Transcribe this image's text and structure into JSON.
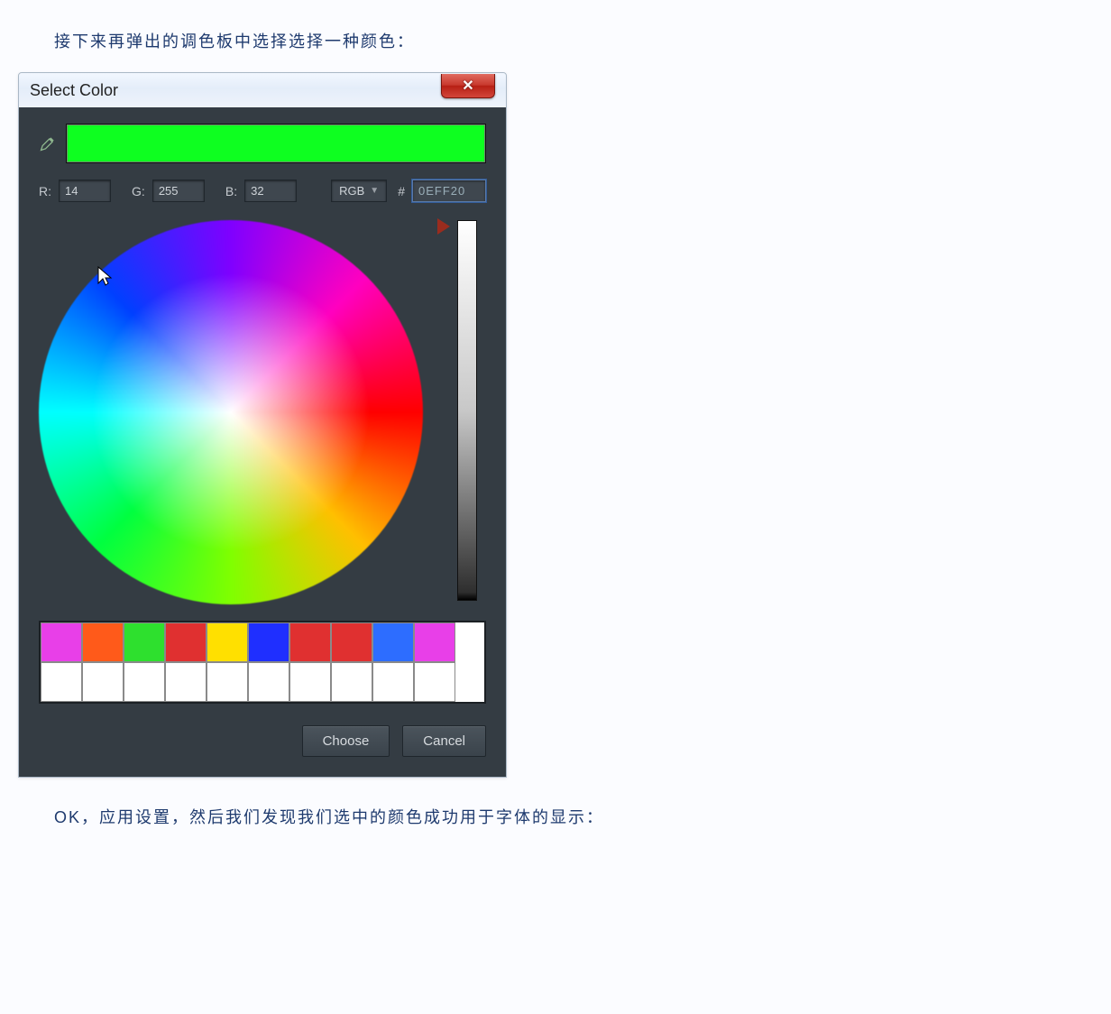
{
  "intro_text": "接下来再弹出的调色板中选择选择一种颜色：",
  "outro_text": "OK，应用设置，然后我们发现我们选中的颜色成功用于字体的显示：",
  "dialog": {
    "title": "Select Color",
    "close_glyph": "✕",
    "preview_color": "#0EFF20",
    "r_label": "R:",
    "g_label": "G:",
    "b_label": "B:",
    "r": "14",
    "g": "255",
    "b": "32",
    "mode": "RGB",
    "hash": "#",
    "hex": "0EFF20",
    "swatches_row1": [
      "#e83fe8",
      "#ff5a1a",
      "#2ee02e",
      "#e03030",
      "#ffe000",
      "#1f2fff",
      "#e03030",
      "#e03030",
      "#2d6dff",
      "#e83fe8"
    ],
    "swatches_row2": [
      "#ffffff",
      "#ffffff",
      "#ffffff",
      "#ffffff",
      "#ffffff",
      "#ffffff",
      "#ffffff",
      "#ffffff",
      "#ffffff",
      "#ffffff"
    ],
    "choose": "Choose",
    "cancel": "Cancel"
  }
}
